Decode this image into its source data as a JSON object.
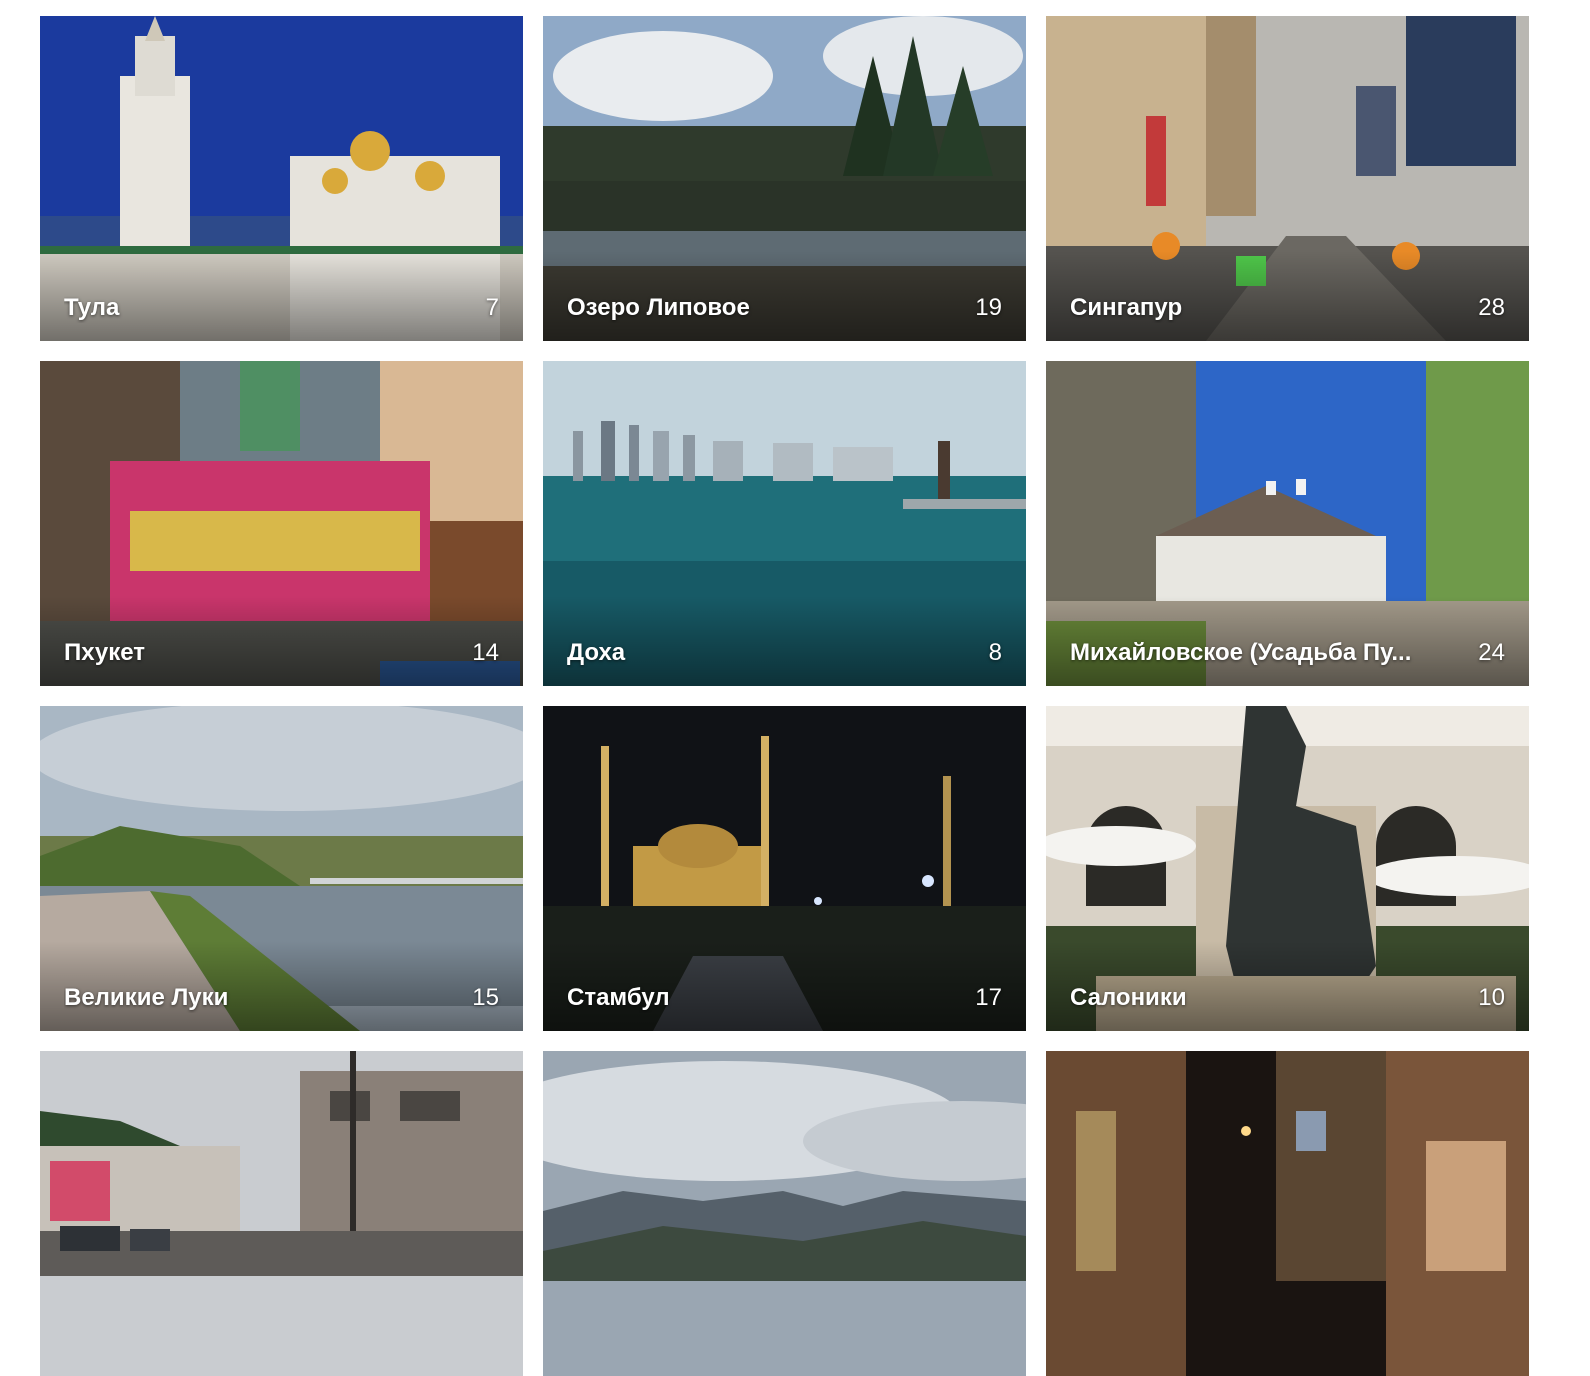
{
  "albums": [
    {
      "title": "Тула",
      "count": "7",
      "scene": "tula-kremlin"
    },
    {
      "title": "Озеро Липовое",
      "count": "19",
      "scene": "lake-forest"
    },
    {
      "title": "Сингапур",
      "count": "28",
      "scene": "city-street"
    },
    {
      "title": "Пхукет",
      "count": "14",
      "scene": "mall-decor"
    },
    {
      "title": "Доха",
      "count": "8",
      "scene": "bay-skyline"
    },
    {
      "title": "Михайловское (Усадьба Пу...",
      "count": "24",
      "scene": "manor-house"
    },
    {
      "title": "Великие Луки",
      "count": "15",
      "scene": "river-promenade"
    },
    {
      "title": "Стамбул",
      "count": "17",
      "scene": "mosque-night"
    },
    {
      "title": "Салоники",
      "count": "10",
      "scene": "statue-square"
    },
    {
      "title": "",
      "count": "",
      "scene": "mountain-town-street"
    },
    {
      "title": "",
      "count": "",
      "scene": "mountain-valley"
    },
    {
      "title": "",
      "count": "",
      "scene": "night-alley"
    }
  ]
}
